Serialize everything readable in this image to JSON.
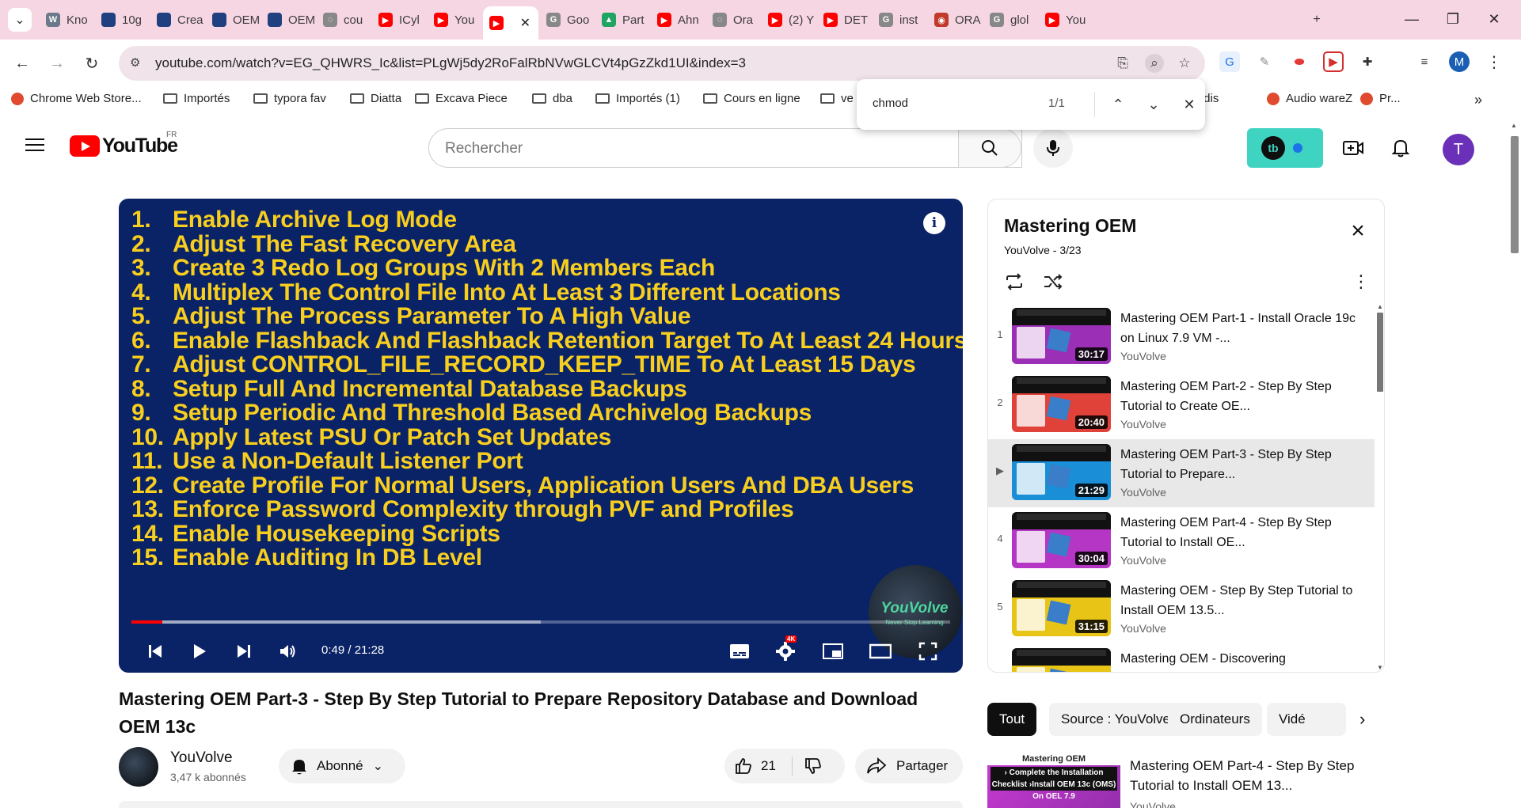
{
  "browser": {
    "tabs": [
      {
        "label": "Kno",
        "fav_color": "#6b7a8a",
        "fav": "W"
      },
      {
        "label": "10g",
        "fav_color": "#204080",
        "fav": ""
      },
      {
        "label": "Crea",
        "fav_color": "#204080",
        "fav": ""
      },
      {
        "label": "OEM",
        "fav_color": "#204080",
        "fav": ""
      },
      {
        "label": "OEM",
        "fav_color": "#204080",
        "fav": ""
      },
      {
        "label": "cou",
        "fav_color": "#888888",
        "fav": "◌"
      },
      {
        "label": "ICyl",
        "fav_color": "#ff0000",
        "fav": "▶"
      },
      {
        "label": "You",
        "fav_color": "#ff0000",
        "fav": "▶"
      },
      {
        "label": "",
        "fav_color": "#ff0000",
        "fav": "▶"
      },
      {
        "label": "Goo",
        "fav_color": "#888888",
        "fav": "G"
      },
      {
        "label": "Part",
        "fav_color": "#1fa463",
        "fav": "▲"
      },
      {
        "label": "Ahn",
        "fav_color": "#ff0000",
        "fav": "▶"
      },
      {
        "label": "Ora",
        "fav_color": "#888888",
        "fav": "◌"
      },
      {
        "label": "(2) Y",
        "fav_color": "#ff0000",
        "fav": "▶"
      },
      {
        "label": "DET",
        "fav_color": "#ff0000",
        "fav": "▶"
      },
      {
        "label": "inst",
        "fav_color": "#888888",
        "fav": "G"
      },
      {
        "label": "ORA",
        "fav_color": "#c0392b",
        "fav": "◉"
      },
      {
        "label": "glol",
        "fav_color": "#888888",
        "fav": "G"
      },
      {
        "label": "You",
        "fav_color": "#ff0000",
        "fav": "▶"
      }
    ],
    "new_tab": "+",
    "url": "youtube.com/watch?v=EG_QHWRS_Ic&list=PLgWj5dy2RoFalRbNVwGLCVt4pGzZkd1UI&index=3",
    "profile_initial": "M",
    "bookmarks": [
      {
        "label": "Chrome Web Store...",
        "type": "app"
      },
      {
        "label": "Importés",
        "type": "folder"
      },
      {
        "label": "typora fav",
        "type": "folder"
      },
      {
        "label": "Diatta",
        "type": "folder"
      },
      {
        "label": "Excava Piece",
        "type": "folder"
      },
      {
        "label": "dba",
        "type": "folder"
      },
      {
        "label": "Importés (1)",
        "type": "folder"
      },
      {
        "label": "Cours en ligne",
        "type": "folder"
      },
      {
        "label": "ve",
        "type": "folder"
      },
      {
        "label": "Hardis",
        "type": "text"
      },
      {
        "label": "Audio wareZ",
        "type": "app"
      },
      {
        "label": "Pr...",
        "type": "app"
      }
    ],
    "find": {
      "query": "chmod",
      "count": "1/1"
    }
  },
  "youtube": {
    "logo_text": "YouTube",
    "country": "FR",
    "search_placeholder": "Rechercher",
    "avatar_initial": "T"
  },
  "player": {
    "slide_lines": [
      {
        "n": "1.",
        "t": "Enable Archive Log Mode"
      },
      {
        "n": "2.",
        "t": "Adjust The Fast Recovery Area"
      },
      {
        "n": "3.",
        "t": "Create 3 Redo Log Groups With 2 Members Each"
      },
      {
        "n": "4.",
        "t": "Multiplex The Control File Into At Least 3 Different Locations"
      },
      {
        "n": "5.",
        "t": "Adjust The Process Parameter To A High Value"
      },
      {
        "n": "6.",
        "t": "Enable Flashback And Flashback Retention Target To At Least 24 Hours"
      },
      {
        "n": "7.",
        "t": "Adjust CONTROL_FILE_RECORD_KEEP_TIME To At Least 15 Days"
      },
      {
        "n": "8.",
        "t": "Setup Full And Incremental Database Backups"
      },
      {
        "n": "9.",
        "t": "Setup Periodic And Threshold Based Archivelog Backups"
      },
      {
        "n": "10.",
        "t": "Apply Latest PSU Or Patch Set Updates"
      },
      {
        "n": "11.",
        "t": "Use a Non-Default Listener Port"
      },
      {
        "n": "12.",
        "t": "Create Profile For Normal Users, Application Users And DBA Users"
      },
      {
        "n": "13.",
        "t": "Enforce Password Complexity through PVF and Profiles"
      },
      {
        "n": "14.",
        "t": "Enable Housekeeping Scripts"
      },
      {
        "n": "15.",
        "t": "Enable Auditing In DB Level"
      }
    ],
    "watermark_title": "YouVolve",
    "watermark_tagline": "Never Stop Learning",
    "current_time": "0:49",
    "duration": "21:28",
    "played_fraction": 0.038,
    "buffered_fraction": 0.5,
    "quality_badge": "4K"
  },
  "video": {
    "title": "Mastering OEM Part-3 - Step By Step Tutorial to Prepare Repository Database and Download OEM 13c",
    "channel": "YouVolve",
    "subscribers": "3,47 k abonnés",
    "subscribe_label": "Abonné",
    "likes": "21",
    "share_label": "Partager"
  },
  "playlist": {
    "title": "Mastering OEM",
    "meta": "YouVolve - 3/23",
    "items": [
      {
        "index": "1",
        "title": "Mastering OEM Part-1 - Install Oracle 19c on Linux 7.9 VM -...",
        "channel": "YouVolve",
        "duration": "30:17",
        "color": "#9b2fb5"
      },
      {
        "index": "2",
        "title": "Mastering OEM Part-2 - Step By Step Tutorial to Create OE...",
        "channel": "YouVolve",
        "duration": "20:40",
        "color": "#e0423a"
      },
      {
        "index": "▶",
        "title": "Mastering OEM Part-3 - Step By Step Tutorial to Prepare...",
        "channel": "YouVolve",
        "duration": "21:29",
        "color": "#1a8fd8",
        "current": true
      },
      {
        "index": "4",
        "title": "Mastering OEM Part-4 - Step By Step Tutorial to Install OE...",
        "channel": "YouVolve",
        "duration": "30:04",
        "color": "#b536c4"
      },
      {
        "index": "5",
        "title": "Mastering OEM - Step By Step Tutorial to Install OEM 13.5...",
        "channel": "YouVolve",
        "duration": "31:15",
        "color": "#e8c417"
      },
      {
        "index": "",
        "title": "Mastering OEM - Discovering",
        "channel": "",
        "duration": "",
        "color": "#e8c417"
      }
    ]
  },
  "chips": [
    "Tout",
    "Source : YouVolve",
    "Ordinateurs",
    "Vidé"
  ],
  "related": {
    "title": "Mastering OEM Part-4 - Step By Step Tutorial to Install OEM 13...",
    "channel": "YouVolve",
    "thumb_header": "Mastering OEM",
    "thumb_band": "› Complete the Installation Checklist ›Install OEM 13c (OMS) On OEL 7.9"
  }
}
